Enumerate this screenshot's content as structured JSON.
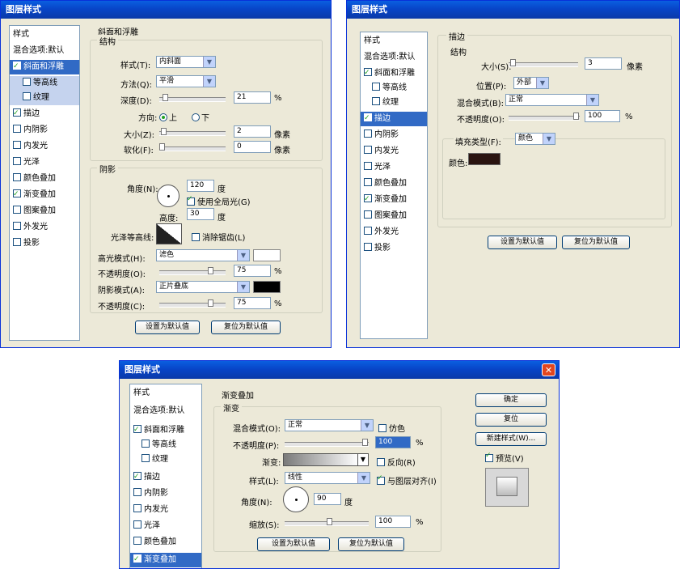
{
  "dialog1": {
    "title": "图层样式",
    "styles_header": "样式",
    "styles_items": [
      "混合选项:默认",
      "斜面和浮雕",
      "等高线",
      "纹理",
      "描边",
      "内阴影",
      "内发光",
      "光泽",
      "颜色叠加",
      "渐变叠加",
      "图案叠加",
      "外发光",
      "投影"
    ],
    "section_title": "斜面和浮雕",
    "structure_title": "结构",
    "style_label": "样式(T):",
    "style_value": "内斜面",
    "method_label": "方法(Q):",
    "method_value": "平滑",
    "depth_label": "深度(D):",
    "depth_value": "21",
    "depth_unit": "%",
    "direction_label": "方向:",
    "dir_up": "上",
    "dir_down": "下",
    "size_label": "大小(Z):",
    "size_value": "2",
    "size_unit": "像素",
    "soften_label": "软化(F):",
    "soften_value": "0",
    "soften_unit": "像素",
    "shading_title": "阴影",
    "angle_label": "角度(N):",
    "angle_value": "120",
    "angle_unit": "度",
    "global_light_label": "使用全局光(G)",
    "altitude_label": "高度:",
    "altitude_value": "30",
    "altitude_unit": "度",
    "gloss_label": "光泽等高线:",
    "antialias_label": "消除锯齿(L)",
    "highlight_label": "高光模式(H):",
    "highlight_value": "滤色",
    "opacity1_label": "不透明度(O):",
    "opacity1_value": "75",
    "opacity_unit": "%",
    "shadow_label": "阴影模式(A):",
    "shadow_value": "正片叠底",
    "opacity2_label": "不透明度(C):",
    "opacity2_value": "75",
    "btn_default": "设置为默认值",
    "btn_reset": "复位为默认值"
  },
  "dialog2": {
    "title": "图层样式",
    "styles_header": "样式",
    "styles_items": [
      "混合选项:默认",
      "斜面和浮雕",
      "等高线",
      "纹理",
      "描边",
      "内阴影",
      "内发光",
      "光泽",
      "颜色叠加",
      "渐变叠加",
      "图案叠加",
      "外发光",
      "投影"
    ],
    "section_title": "描边",
    "structure_title": "结构",
    "size_label": "大小(S):",
    "size_value": "3",
    "size_unit": "像素",
    "position_label": "位置(P):",
    "position_value": "外部",
    "blend_label": "混合模式(B):",
    "blend_value": "正常",
    "opacity_label": "不透明度(O):",
    "opacity_value": "100",
    "opacity_unit": "%",
    "fill_type_label": "填充类型(F):",
    "fill_type_value": "颜色",
    "color_label": "颜色:",
    "color_hex": "#2a1410",
    "btn_default": "设置为默认值",
    "btn_reset": "复位为默认值"
  },
  "dialog3": {
    "title": "图层样式",
    "styles_header": "样式",
    "styles_items": [
      "混合选项:默认",
      "斜面和浮雕",
      "等高线",
      "纹理",
      "描边",
      "内阴影",
      "内发光",
      "光泽",
      "颜色叠加",
      "渐变叠加"
    ],
    "section_title": "渐变叠加",
    "gradient_title": "渐变",
    "blend_label": "混合模式(O):",
    "blend_value": "正常",
    "dither_label": "仿色",
    "opacity_label": "不透明度(P):",
    "opacity_value": "100",
    "opacity_unit": "%",
    "gradient_label": "渐变:",
    "reverse_label": "反向(R)",
    "style_label": "样式(L):",
    "style_value": "线性",
    "align_label": "与图层对齐(I)",
    "angle_label": "角度(N):",
    "angle_value": "90",
    "angle_unit": "度",
    "scale_label": "缩放(S):",
    "scale_value": "100",
    "scale_unit": "%",
    "btn_default": "设置为默认值",
    "btn_reset": "复位为默认值",
    "btn_ok": "确定",
    "btn_cancel": "复位",
    "btn_new_style": "新建样式(W)...",
    "preview_label": "预览(V)"
  }
}
